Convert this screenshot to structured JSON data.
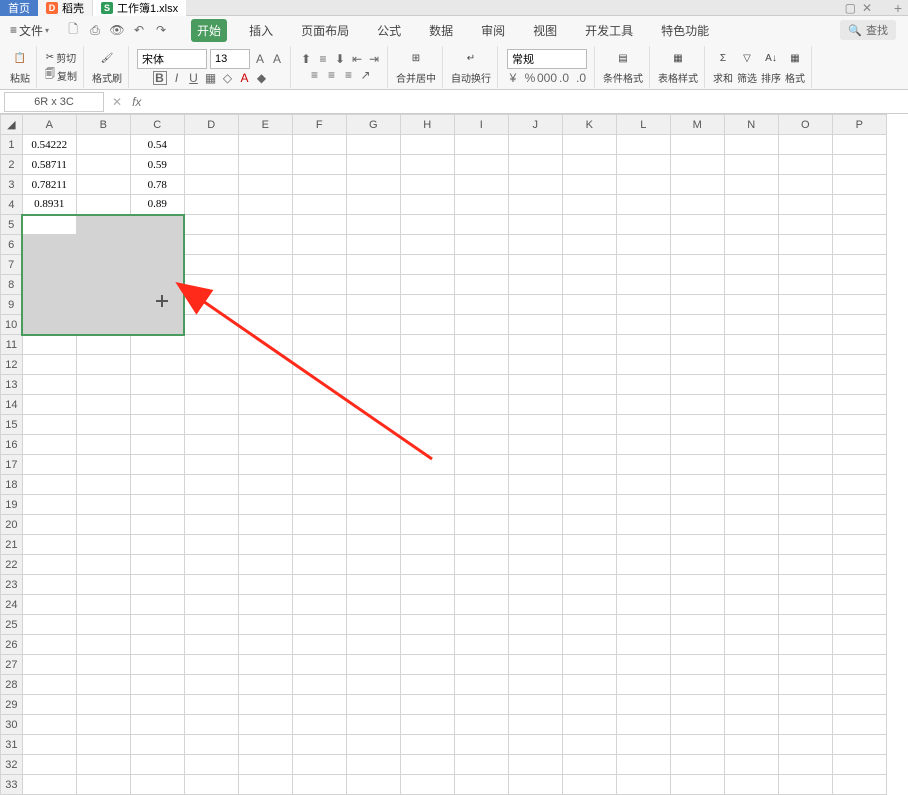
{
  "tabs": {
    "home": "首页",
    "daoke": "稻壳",
    "workbook": "工作簿1.xlsx"
  },
  "menu": {
    "file": "文件",
    "ribbon_tabs": [
      "开始",
      "插入",
      "页面布局",
      "公式",
      "数据",
      "审阅",
      "视图",
      "开发工具",
      "特色功能"
    ],
    "search": "查找"
  },
  "ribbon": {
    "paste": "粘贴",
    "cut": "剪切",
    "copy": "复制",
    "format_painter": "格式刷",
    "font_name": "宋体",
    "font_size": "13",
    "merge_center": "合并居中",
    "wrap_text": "自动换行",
    "number_format": "常规",
    "cond_format": "条件格式",
    "table_style": "表格样式",
    "sum": "求和",
    "filter": "筛选",
    "sort": "排序",
    "format": "格式"
  },
  "namebox": "6R x 3C",
  "columns": [
    "A",
    "B",
    "C",
    "D",
    "E",
    "F",
    "G",
    "H",
    "I",
    "J",
    "K",
    "L",
    "M",
    "N",
    "O",
    "P"
  ],
  "row_count": 33,
  "cells": {
    "A1": "0.54222",
    "C1": "0.54",
    "A2": "0.58711",
    "C2": "0.59",
    "A3": "0.78211",
    "C3": "0.78",
    "A4": "0.8931",
    "C4": "0.89"
  },
  "selection": {
    "r1": 5,
    "c1": 1,
    "r2": 10,
    "c2": 3
  }
}
